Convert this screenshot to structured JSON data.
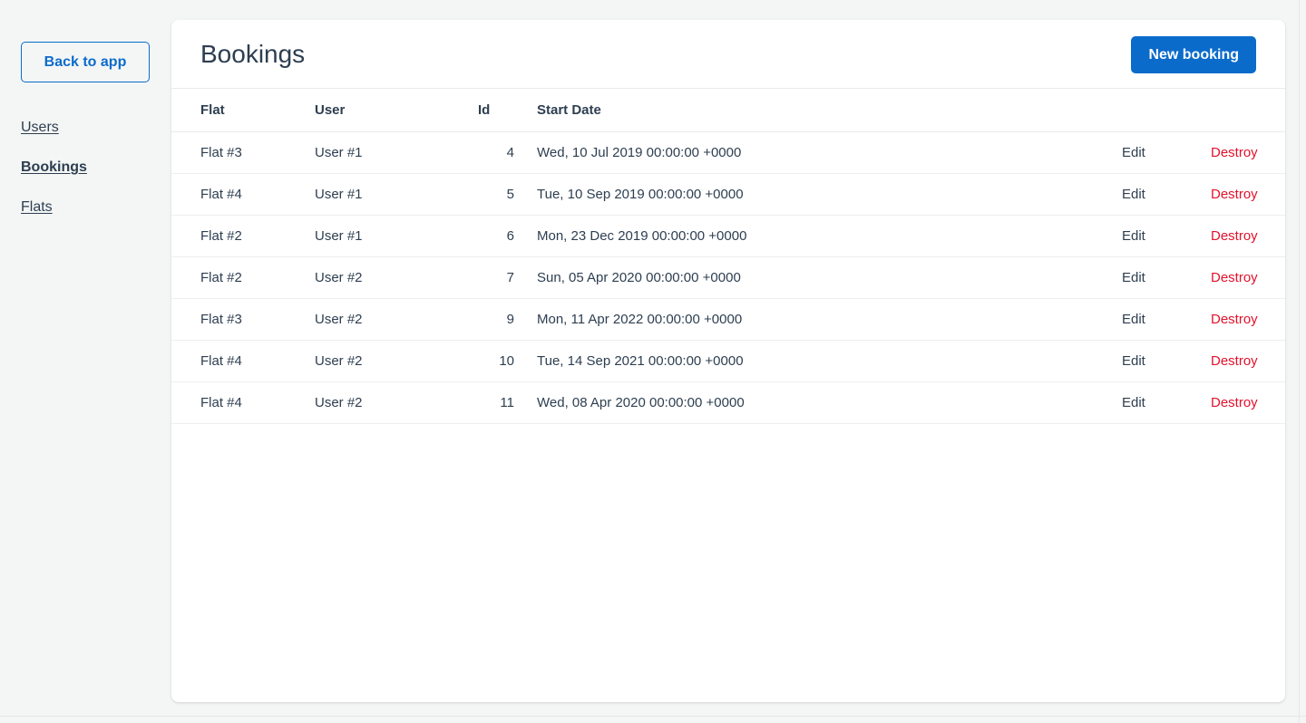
{
  "sidebar": {
    "back_button": "Back to app",
    "items": [
      {
        "label": "Users",
        "active": false
      },
      {
        "label": "Bookings",
        "active": true
      },
      {
        "label": "Flats",
        "active": false
      }
    ]
  },
  "card": {
    "title": "Bookings",
    "new_button": "New booking"
  },
  "table": {
    "headers": {
      "flat": "Flat",
      "user": "User",
      "id": "Id",
      "start_date": "Start Date"
    },
    "actions": {
      "edit": "Edit",
      "destroy": "Destroy"
    },
    "rows": [
      {
        "flat": "Flat #3",
        "user": "User #1",
        "id": "4",
        "start_date": "Wed, 10 Jul 2019 00:00:00 +0000"
      },
      {
        "flat": "Flat #4",
        "user": "User #1",
        "id": "5",
        "start_date": "Tue, 10 Sep 2019 00:00:00 +0000"
      },
      {
        "flat": "Flat #2",
        "user": "User #1",
        "id": "6",
        "start_date": "Mon, 23 Dec 2019 00:00:00 +0000"
      },
      {
        "flat": "Flat #2",
        "user": "User #2",
        "id": "7",
        "start_date": "Sun, 05 Apr 2020 00:00:00 +0000"
      },
      {
        "flat": "Flat #3",
        "user": "User #2",
        "id": "9",
        "start_date": "Mon, 11 Apr 2022 00:00:00 +0000"
      },
      {
        "flat": "Flat #4",
        "user": "User #2",
        "id": "10",
        "start_date": "Tue, 14 Sep 2021 00:00:00 +0000"
      },
      {
        "flat": "Flat #4",
        "user": "User #2",
        "id": "11",
        "start_date": "Wed, 08 Apr 2020 00:00:00 +0000"
      }
    ]
  },
  "colors": {
    "accent": "#0b6bcb",
    "text": "#2d3e50",
    "danger": "#e3112c",
    "page_background": "#f4f6f6",
    "card_background": "#ffffff",
    "border": "#e7eaec"
  }
}
